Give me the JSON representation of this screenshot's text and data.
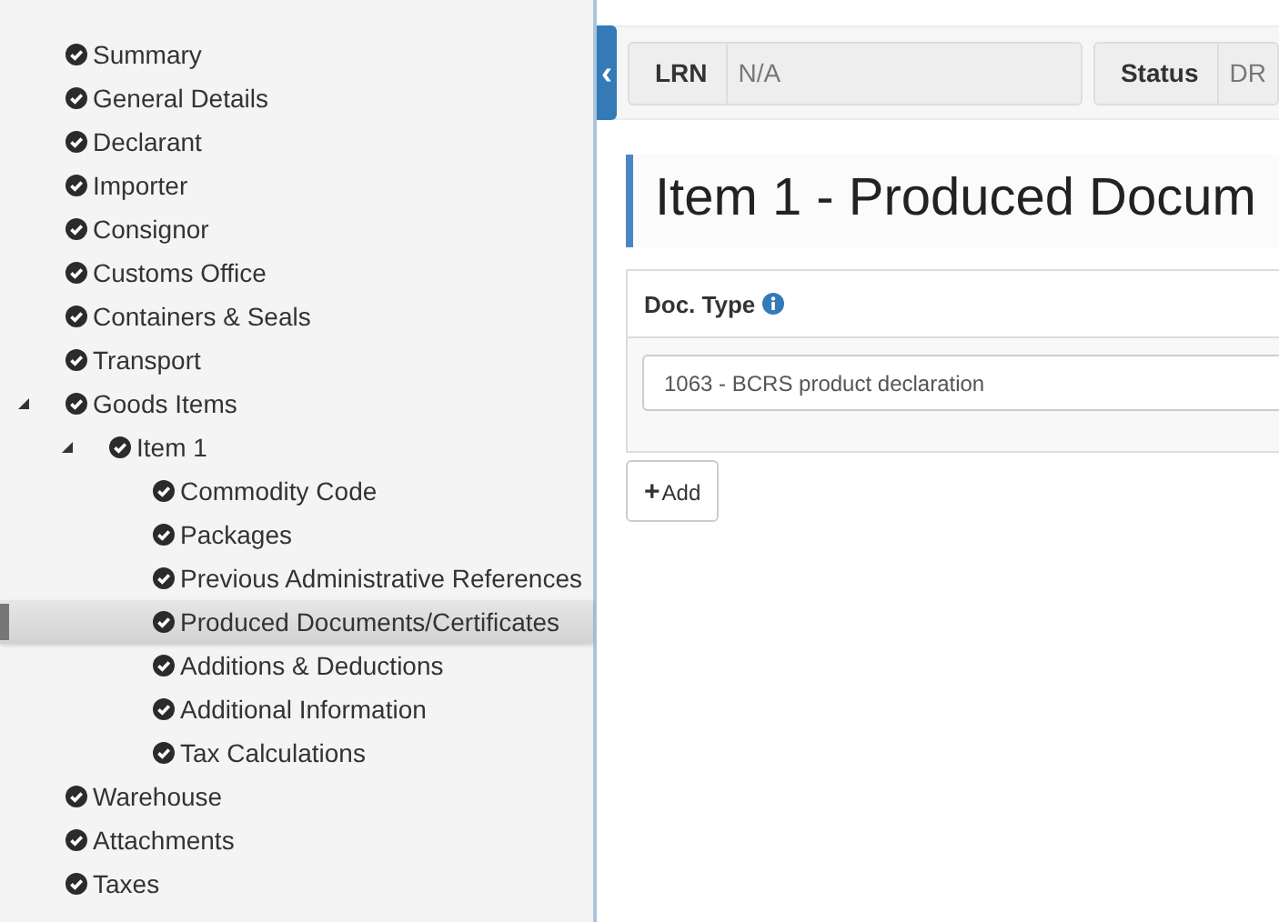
{
  "sidebar": {
    "items": [
      {
        "label": "Summary",
        "done": true,
        "selected": false
      },
      {
        "label": "General Details",
        "done": true,
        "selected": false
      },
      {
        "label": "Declarant",
        "done": true,
        "selected": false
      },
      {
        "label": "Importer",
        "done": true,
        "selected": false
      },
      {
        "label": "Consignor",
        "done": true,
        "selected": false
      },
      {
        "label": "Customs Office",
        "done": true,
        "selected": false
      },
      {
        "label": "Containers & Seals",
        "done": true,
        "selected": false
      },
      {
        "label": "Transport",
        "done": true,
        "selected": false
      },
      {
        "label": "Goods Items",
        "done": true,
        "selected": false,
        "expanded": true,
        "children": [
          {
            "label": "Item 1",
            "done": true,
            "selected": false,
            "expanded": true,
            "children": [
              {
                "label": "Commodity Code",
                "done": true,
                "selected": false
              },
              {
                "label": "Packages",
                "done": true,
                "selected": false
              },
              {
                "label": "Previous Administrative References",
                "done": true,
                "selected": false
              },
              {
                "label": "Produced Documents/Certificates",
                "done": true,
                "selected": true
              },
              {
                "label": "Additions & Deductions",
                "done": true,
                "selected": false
              },
              {
                "label": "Additional Information",
                "done": true,
                "selected": false
              },
              {
                "label": "Tax Calculations",
                "done": true,
                "selected": false
              }
            ]
          }
        ]
      },
      {
        "label": "Warehouse",
        "done": true,
        "selected": false
      },
      {
        "label": "Attachments",
        "done": true,
        "selected": false
      },
      {
        "label": "Taxes",
        "done": true,
        "selected": false
      }
    ]
  },
  "header": {
    "collapse_button": "‹",
    "fields": [
      {
        "label": "LRN",
        "value": "N/A"
      },
      {
        "label": "Status",
        "value": "DR"
      }
    ]
  },
  "page_title": "Item 1 - Produced Docum",
  "panel": {
    "column_label": "Doc. Type",
    "doc_type_value": "1063 - BCRS product declaration"
  },
  "add_button": {
    "icon": "+",
    "label": "Add"
  }
}
